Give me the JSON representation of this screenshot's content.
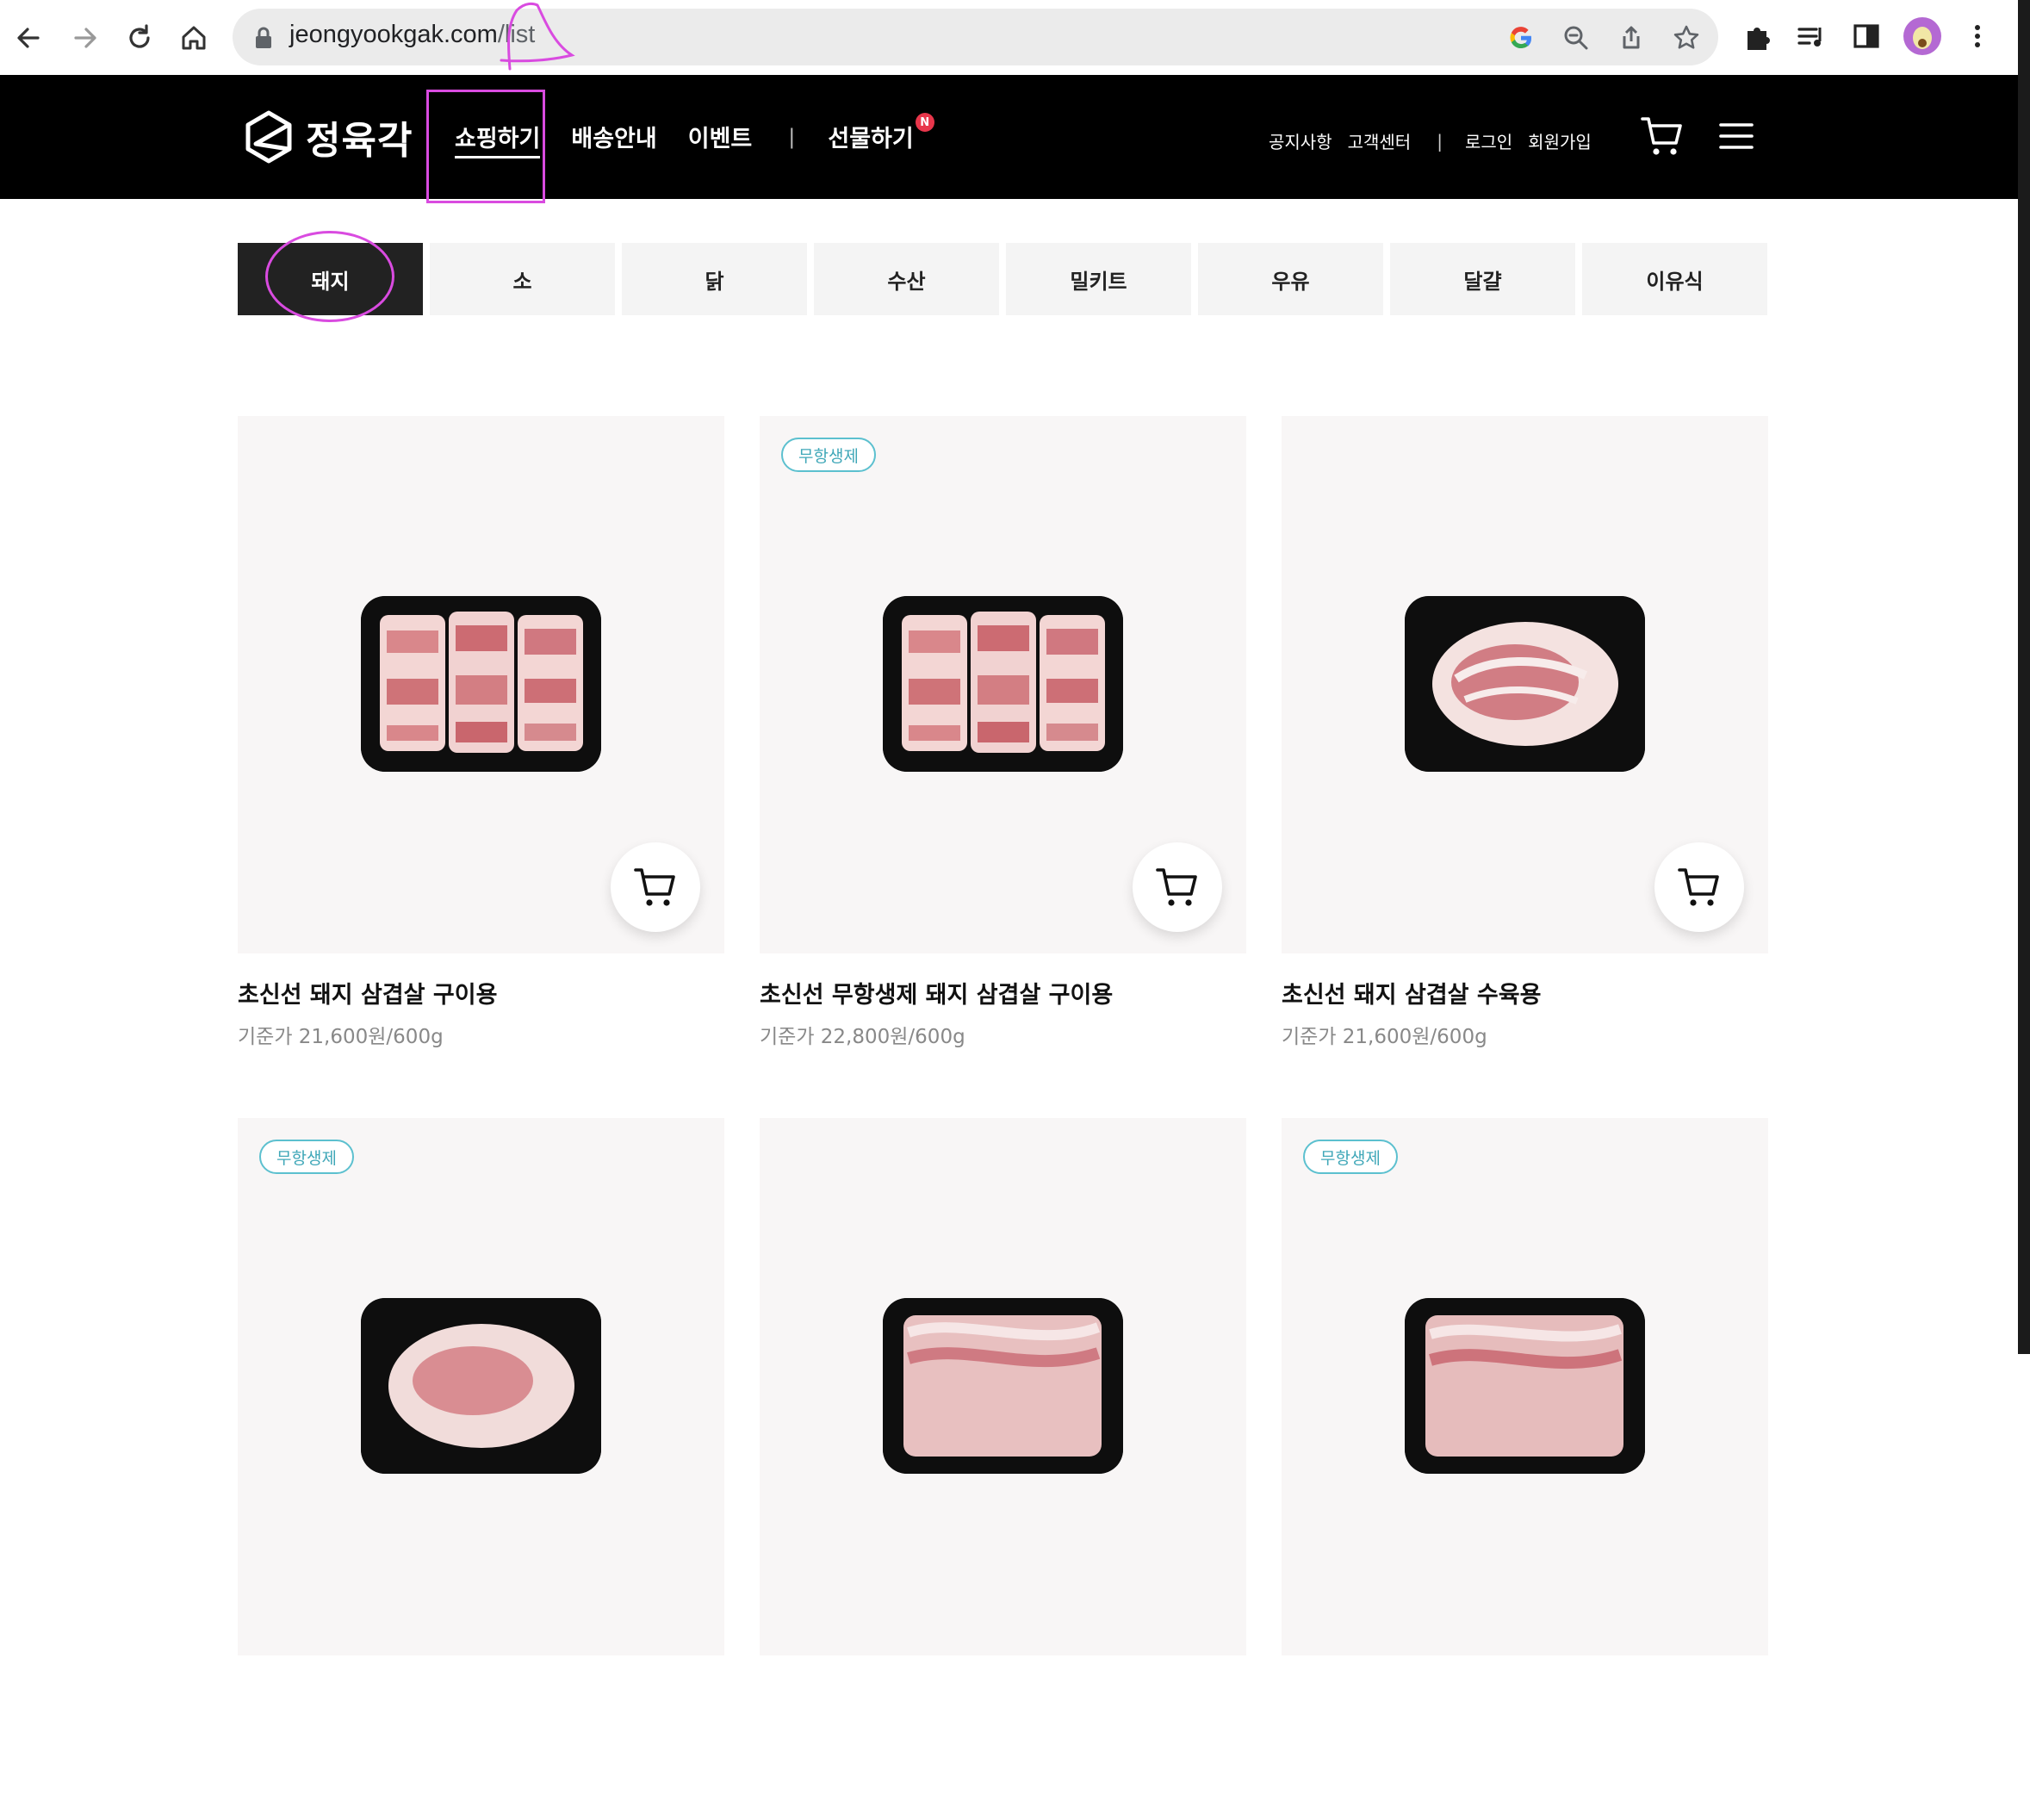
{
  "browser": {
    "url_host": "jeongyookgak.com",
    "url_path": "/list"
  },
  "site": {
    "logo_text": "정육각",
    "nav": [
      "쇼핑하기",
      "배송안내",
      "이벤트",
      "선물하기"
    ],
    "nav_badge": "N",
    "util": [
      "공지사항",
      "고객센터",
      "로그인",
      "회원가입"
    ],
    "separator": "|"
  },
  "categories": [
    "돼지",
    "소",
    "닭",
    "수산",
    "밀키트",
    "우유",
    "달걀",
    "이유식"
  ],
  "products": [
    {
      "name": "초신선 돼지 삼겹살 구이용",
      "price": "기준가 21,600원/600g",
      "tag": ""
    },
    {
      "name": "초신선 무항생제 돼지 삼겹살 구이용",
      "price": "기준가 22,800원/600g",
      "tag": "무항생제"
    },
    {
      "name": "초신선 돼지 삼겹살 수육용",
      "price": "기준가 21,600원/600g",
      "tag": ""
    },
    {
      "name": "",
      "price": "",
      "tag": "무항생제"
    },
    {
      "name": "",
      "price": "",
      "tag": ""
    },
    {
      "name": "",
      "price": "",
      "tag": "무항생제"
    }
  ],
  "colors": {
    "header_bg": "#000000",
    "active_tab": "#222222",
    "tag_border": "#5cc0cf",
    "annotation": "#d94be0",
    "badge": "#e8364b"
  }
}
